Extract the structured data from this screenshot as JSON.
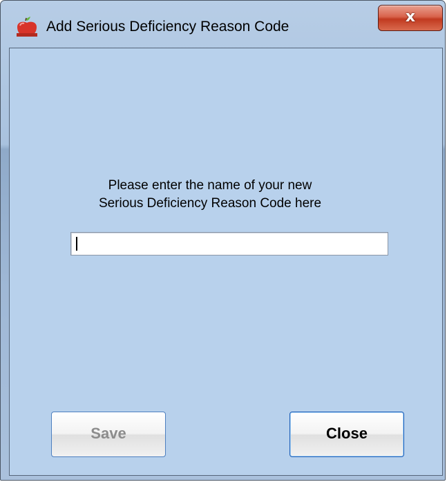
{
  "window": {
    "title": "Add Serious Deficiency Reason Code",
    "icon": "app-apple-icon",
    "close_glyph": "x"
  },
  "dialog": {
    "prompt_line1": "Please enter the name of your new",
    "prompt_line2": "Serious Deficiency Reason Code here",
    "input_value": "",
    "input_placeholder": ""
  },
  "buttons": {
    "save_label": "Save",
    "save_enabled": false,
    "close_label": "Close"
  },
  "colors": {
    "client_background": "#b8d1ec",
    "close_button_red": "#c13a20",
    "button_border_blue": "#1f5fb8"
  }
}
